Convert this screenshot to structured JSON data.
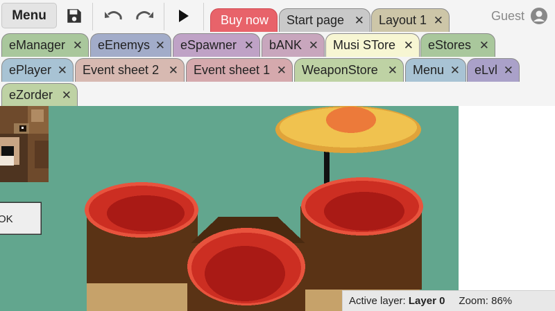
{
  "toolbar": {
    "menu_label": "Menu",
    "save_icon": "floppy-disk-icon",
    "undo_icon": "undo-icon",
    "redo_icon": "redo-icon",
    "play_icon": "play-icon"
  },
  "user": {
    "name": "Guest",
    "icon": "user-circle-icon"
  },
  "tabs_row1": [
    {
      "label": "Buy now",
      "closable": false,
      "color": "#e8636a"
    },
    {
      "label": "Start page",
      "closable": true,
      "color": "#c9c9c9"
    },
    {
      "label": "Layout 1",
      "closable": true,
      "color": "#cdc6a8"
    }
  ],
  "tabs_row2": [
    {
      "label": "eManager",
      "closable": true,
      "color": "#a9c79c"
    },
    {
      "label": "eEnemys",
      "closable": true,
      "color": "#a2acc9"
    },
    {
      "label": "eSpawner",
      "closable": true,
      "color": "#bfa2c6"
    },
    {
      "label": "bANK",
      "closable": true,
      "color": "#c8a6bd"
    },
    {
      "label": "Musi STore",
      "closable": true,
      "color": "#f7f6d3"
    },
    {
      "label": "eStores",
      "closable": true,
      "color": "#a9c79c"
    }
  ],
  "tabs_row3": [
    {
      "label": "ePlayer",
      "closable": true,
      "color": "#a8c3d4"
    },
    {
      "label": "Event sheet 2",
      "closable": true,
      "color": "#d7b9b1"
    },
    {
      "label": "Event sheet 1",
      "closable": true,
      "color": "#d5a9ad"
    },
    {
      "label": "WeaponStore",
      "closable": true,
      "color": "#bed2a4"
    },
    {
      "label": "Menu",
      "closable": true,
      "color": "#a8c3d4"
    },
    {
      "label": "eLvl",
      "closable": true,
      "color": "#aaa1c9"
    }
  ],
  "tabs_row4": [
    {
      "label": "eZorder",
      "closable": true,
      "color": "#bed2a4"
    }
  ],
  "canvas": {
    "background": "#62a68e",
    "ok_button_label": "OK"
  },
  "status": {
    "active_layer_label": "Active layer:",
    "active_layer_value": "Layer 0",
    "zoom_label": "Zoom: 86%"
  },
  "tab_close_glyph": "✕"
}
